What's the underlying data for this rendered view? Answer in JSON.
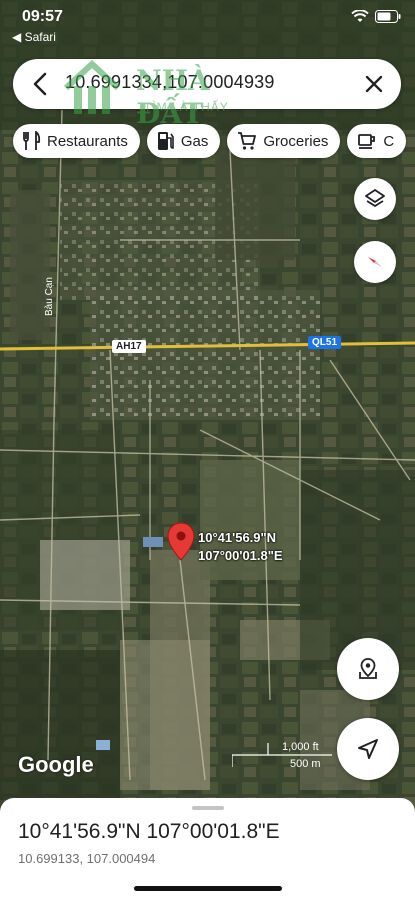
{
  "status_bar": {
    "time": "09:57",
    "back_app": "◀ Safari"
  },
  "search": {
    "query": "10.6991334,107.0004939"
  },
  "watermark": {
    "brand": "NHÀ ĐẤT",
    "tagline": "TÌM LÀ THẤY"
  },
  "chips": [
    {
      "label": "Restaurants",
      "icon": "restaurant-icon"
    },
    {
      "label": "Gas",
      "icon": "gas-station-icon"
    },
    {
      "label": "Groceries",
      "icon": "cart-icon"
    },
    {
      "label": "C",
      "icon": "coffee-icon"
    }
  ],
  "map": {
    "road_labels": {
      "ah17": "AH17",
      "ql51": "QL51",
      "bau_can": "Bàu Cạn"
    },
    "pin_label": {
      "lat": "10°41'56.9\"N",
      "lng": "107°00'01.8\"E"
    },
    "attribution": "Google",
    "scale": {
      "feet": "1,000 ft",
      "meters": "500 m"
    }
  },
  "colors": {
    "route_yellow": "#e0c03a",
    "pin_red": "#e53935",
    "accent_blue": "#1a73e8"
  },
  "sheet": {
    "title": "10°41'56.9\"N 107°00'01.8\"E",
    "subtitle": "10.699133, 107.000494"
  }
}
